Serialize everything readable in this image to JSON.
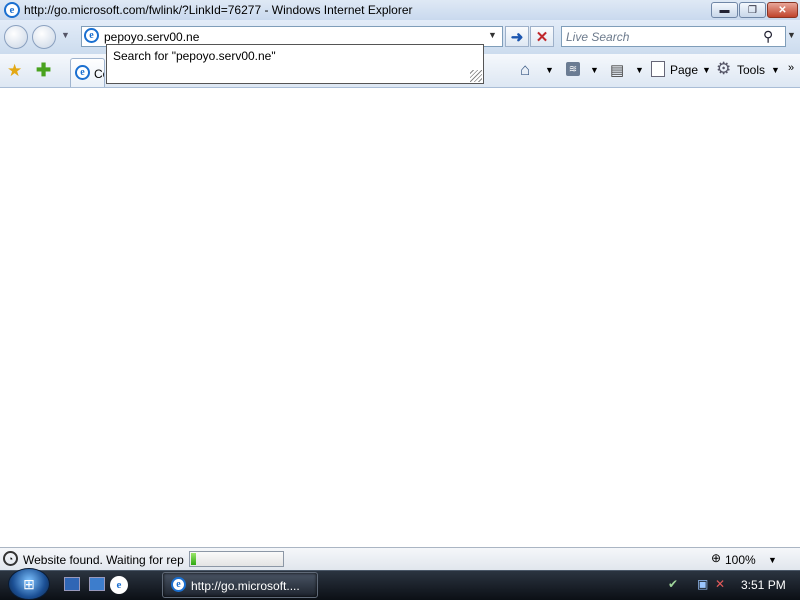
{
  "window": {
    "title": "http://go.microsoft.com/fwlink/?LinkId=76277 - Windows Internet Explorer",
    "min_glyph": "▬",
    "max_glyph": "❐",
    "close_glyph": "✕"
  },
  "nav": {
    "address_value": "pepoyo.serv00.ne",
    "autocomplete_suggestion": "Search for \"pepoyo.serv00.ne\"",
    "search_placeholder": "Live Search",
    "go_glyph": "➜",
    "stop_glyph": "✕"
  },
  "tab": {
    "label": "Co"
  },
  "commandbar": {
    "page_label": "Page",
    "tools_label": "Tools"
  },
  "status": {
    "text": "Website found. Waiting for rep",
    "progress_percent": 6,
    "zoom": "100%"
  },
  "taskbar": {
    "item_label": "http://go.microsoft....",
    "clock": "3:51 PM"
  },
  "icons": {
    "ie": "e",
    "dropdown": "▼",
    "favorites": "★",
    "add_favorites": "✚",
    "home": "⌂",
    "feed": "≋",
    "print": "▤",
    "tools": "⚙",
    "search": "⚲",
    "more": "»",
    "zoom": "⊕",
    "status": "◔",
    "start": "⊞"
  },
  "colors": {
    "titlebar": "#c9d9ee",
    "close_button": "#c0432c",
    "progress_fill": "#2ea811",
    "taskbar": "#0b0f15"
  }
}
